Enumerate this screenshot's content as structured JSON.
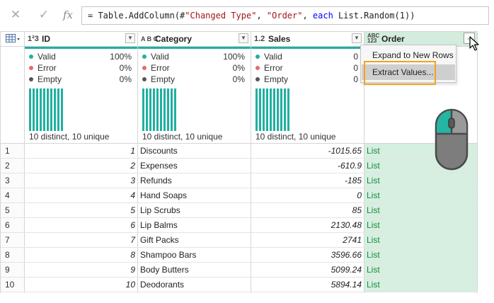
{
  "formula_bar": {
    "cancel_icon": "cancel-x-icon",
    "confirm_icon": "check-icon",
    "fx_label": "fx",
    "formula_prefix": "= Table.AddColumn(#",
    "formula_str1": "\"Changed Type\"",
    "formula_sep": ", ",
    "formula_str2": "\"Order\"",
    "formula_sep2": ", ",
    "formula_kw": "each",
    "formula_rest": " List.Random(1))"
  },
  "columns": [
    {
      "type": "1²3",
      "name": "ID"
    },
    {
      "type": "A B C",
      "name": "Category"
    },
    {
      "type": "1.2",
      "name": "Sales"
    },
    {
      "type": "ABC 123",
      "name": "Order"
    }
  ],
  "profile": [
    {
      "valid": "100%",
      "error": "0%",
      "empty": "0%",
      "distinct": "10 distinct, 10 unique"
    },
    {
      "valid": "100%",
      "error": "0%",
      "empty": "0%",
      "distinct": "10 distinct, 10 unique"
    },
    {
      "valid": "0",
      "error": "0",
      "empty": "0",
      "distinct": "10 distinct, 10 unique"
    }
  ],
  "profile_labels": {
    "valid": "Valid",
    "error": "Error",
    "empty": "Empty"
  },
  "colors": {
    "valid": "#1fb0a0",
    "error": "#e66a6a",
    "empty": "#555555",
    "order_bg": "#d6efe0",
    "highlight": "#f2a41c"
  },
  "rows": [
    {
      "n": "1",
      "id": "1",
      "category": "Discounts",
      "sales": "-1015.65",
      "order": "List"
    },
    {
      "n": "2",
      "id": "2",
      "category": "Expenses",
      "sales": "-610.9",
      "order": "List"
    },
    {
      "n": "3",
      "id": "3",
      "category": "Refunds",
      "sales": "-185",
      "order": "List"
    },
    {
      "n": "4",
      "id": "4",
      "category": "Hand Soaps",
      "sales": "0",
      "order": "List"
    },
    {
      "n": "5",
      "id": "5",
      "category": "Lip Scrubs",
      "sales": "85",
      "order": "List"
    },
    {
      "n": "6",
      "id": "6",
      "category": "Lip Balms",
      "sales": "2130.48",
      "order": "List"
    },
    {
      "n": "7",
      "id": "7",
      "category": "Gift Packs",
      "sales": "2741",
      "order": "List"
    },
    {
      "n": "8",
      "id": "8",
      "category": "Shampoo Bars",
      "sales": "3596.66",
      "order": "List"
    },
    {
      "n": "9",
      "id": "9",
      "category": "Body Butters",
      "sales": "5099.24",
      "order": "List"
    },
    {
      "n": "10",
      "id": "10",
      "category": "Deodorants",
      "sales": "5894.14",
      "order": "List"
    }
  ],
  "menu": {
    "items": [
      "Expand to New Rows",
      "Extract Values..."
    ],
    "selected": 1
  }
}
